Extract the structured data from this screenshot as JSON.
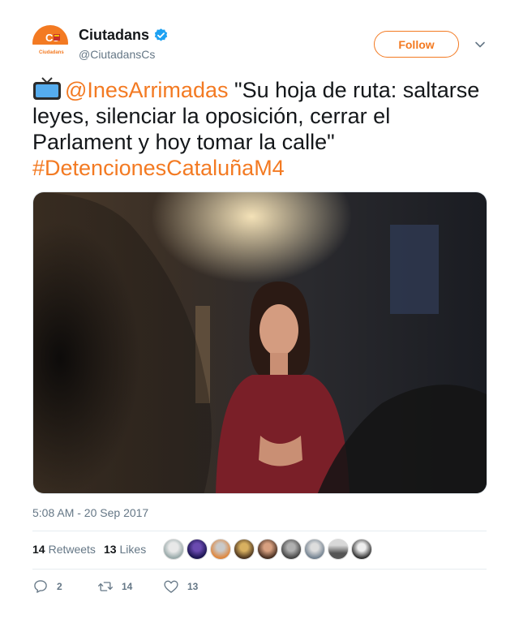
{
  "account": {
    "name": "Ciutadans",
    "handle": "@CiutadansCs",
    "logo_text": "Cs",
    "logo_subtext": "Ciudadans",
    "brand_color": "#f37a22",
    "verified_color": "#1da1f2"
  },
  "follow_label": "Follow",
  "tweet": {
    "mention": "@InesArrimadas",
    "body": " \"Su hoja de ruta: saltarse leyes, silenciar la oposición, cerrar el Parlament y hoy tomar la calle\"",
    "hashtag": "#DetencionesCataluñaM4"
  },
  "timestamp": "5:08 AM - 20 Sep 2017",
  "stats": {
    "retweets_count": "14",
    "retweets_label": "Retweets",
    "likes_count": "13",
    "likes_label": "Likes"
  },
  "actions": {
    "replies": "2",
    "retweets": "14",
    "likes": "13"
  },
  "icons": [
    "television-icon",
    "verified-badge-icon",
    "chevron-down-icon",
    "reply-icon",
    "retweet-icon",
    "heart-icon"
  ]
}
